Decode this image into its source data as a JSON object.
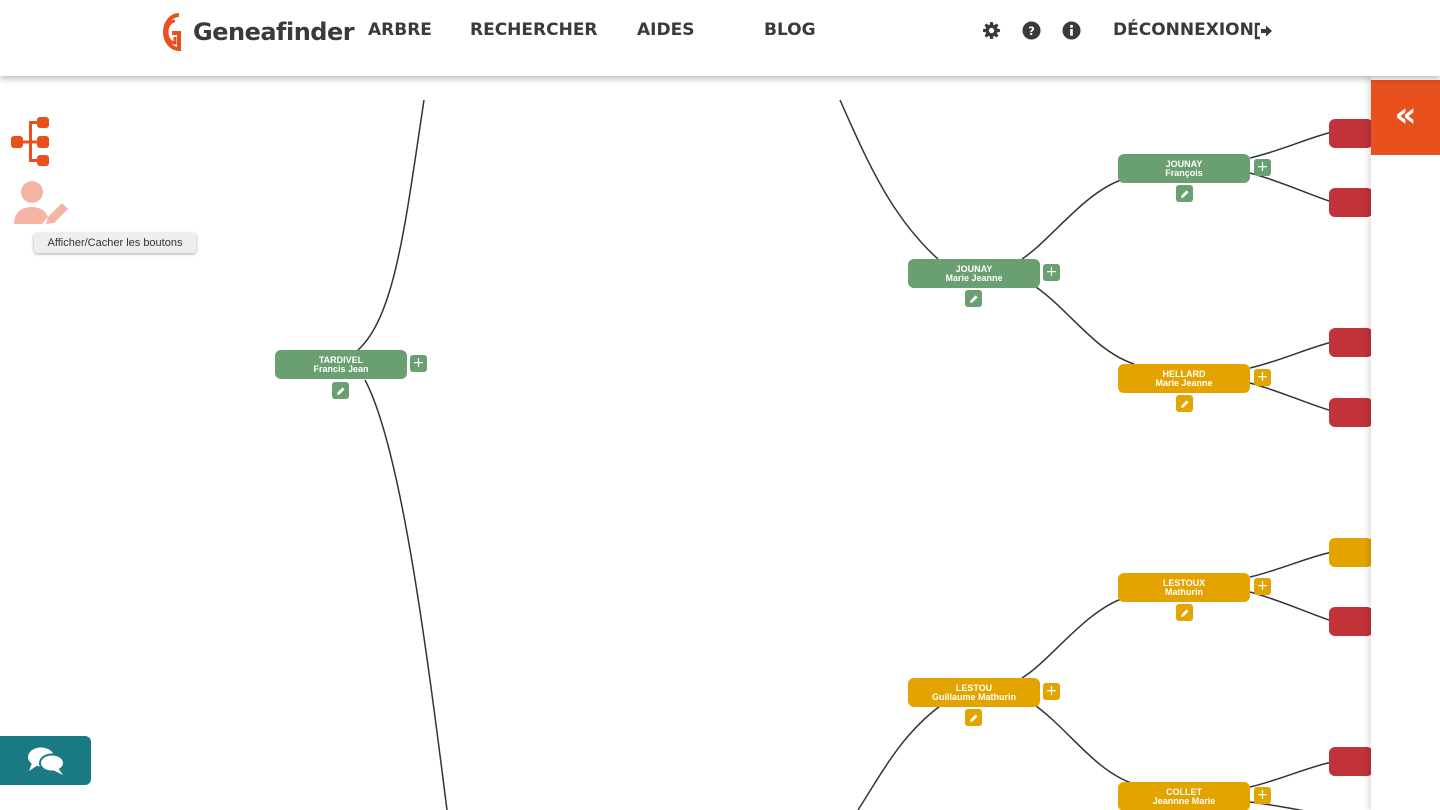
{
  "header": {
    "logo_text": "Geneafinder",
    "nav": [
      "ARBRE",
      "RECHERCHER",
      "AIDES",
      "BLOG"
    ],
    "logout_label": "DÉCONNEXION"
  },
  "toolbar": {
    "tooltip": "Afficher/Cacher les boutons"
  },
  "tree": {
    "nodes": [
      {
        "last": "TARDIVEL",
        "first": "Francis Jean",
        "color": "green"
      },
      {
        "last": "JOUNAY",
        "first": "Marie Jeanne",
        "color": "green"
      },
      {
        "last": "JOUNAY",
        "first": "François",
        "color": "green"
      },
      {
        "last": "HELLARD",
        "first": "Marie Jeanne",
        "color": "yellow"
      },
      {
        "last": "LESTOU",
        "first": "Guillaume Mathurin",
        "color": "yellow"
      },
      {
        "last": "LESTOUX",
        "first": "Mathurin",
        "color": "yellow"
      },
      {
        "last": "COLLET",
        "first": "Jeannne Marie",
        "color": "yellow"
      }
    ]
  },
  "colors": {
    "green": "#6a9f72",
    "yellow": "#e4a400",
    "red": "#c13239",
    "accent": "#e8501e",
    "chat": "#197a84"
  },
  "icons": {
    "settings": "gear-icon",
    "help": "question-circle-icon",
    "info": "info-circle-icon",
    "logout": "sign-out-icon",
    "tree_tool": "sitemap-icon",
    "edit_toggle": "user-edit-icon",
    "chat": "comments-icon",
    "collapse": "double-chevron-left-icon"
  }
}
